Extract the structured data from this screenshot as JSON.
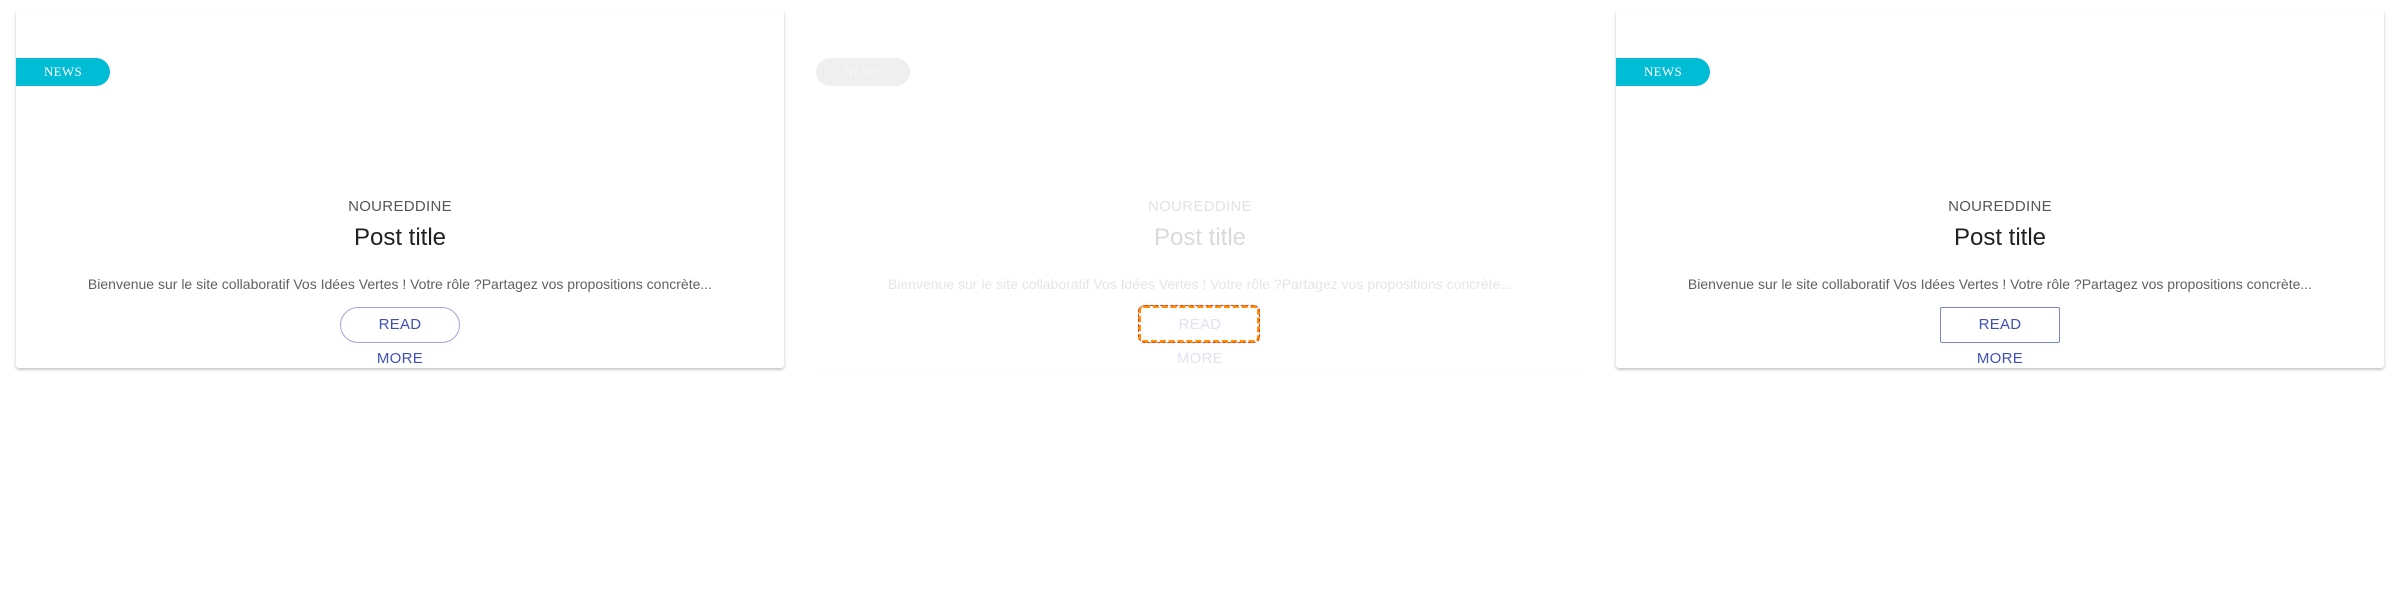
{
  "cards": [
    {
      "badge": "NEWS",
      "author": "NOUREDDINE",
      "title": "Post title",
      "excerpt": "Bienvenue sur le site collaboratif Vos Idées Vertes ! Votre rôle ?Partagez vos propositions concrète...",
      "button": "READ MORE"
    },
    {
      "badge": "NEWS",
      "author": "NOUREDDINE",
      "title": "Post title",
      "excerpt": "Bienvenue sur le site collaboratif Vos Idées Vertes ! Votre rôle ?Partagez vos propositions concrète...",
      "button": "READ MORE"
    },
    {
      "badge": "NEWS",
      "author": "NOUREDDINE",
      "title": "Post title",
      "excerpt": "Bienvenue sur le site collaboratif Vos Idées Vertes ! Votre rôle ?Partagez vos propositions concrète...",
      "button": "READ MORE"
    }
  ],
  "colors": {
    "badge": "#00bcd4",
    "button_text": "#3f51b5",
    "focus_ring": "#ff8f00"
  }
}
